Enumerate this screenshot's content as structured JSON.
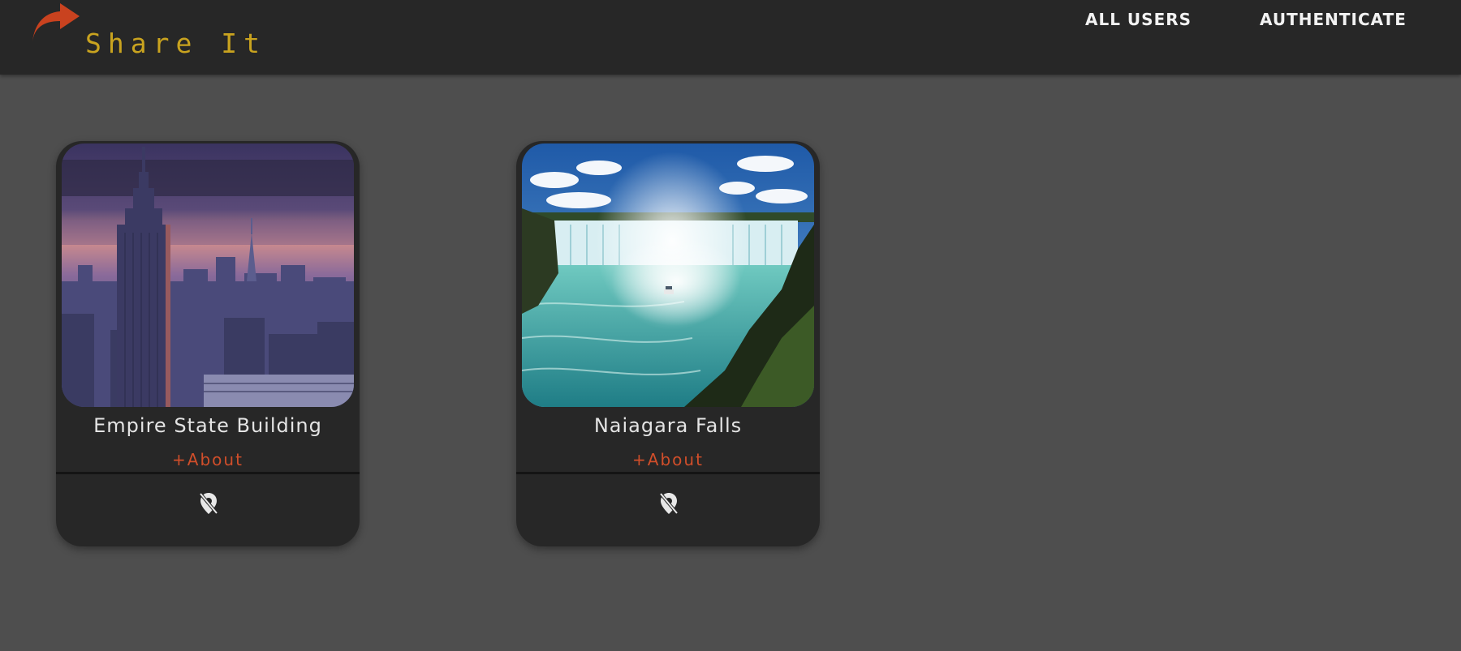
{
  "header": {
    "brand": "Share It",
    "logo_icon": "share-arrow-icon",
    "nav": {
      "all_users": "ALL USERS",
      "authenticate": "AUTHENTICATE"
    }
  },
  "places": [
    {
      "title": "Empire State Building",
      "about_label": "+About",
      "location_icon": "location-off-icon"
    },
    {
      "title": "Naiagara Falls",
      "about_label": "+About",
      "location_icon": "location-off-icon"
    }
  ],
  "colors": {
    "background": "#4e4e4e",
    "header": "#272727",
    "brand": "#c9a31f",
    "accent": "#d04e2a",
    "card": "#272727"
  }
}
